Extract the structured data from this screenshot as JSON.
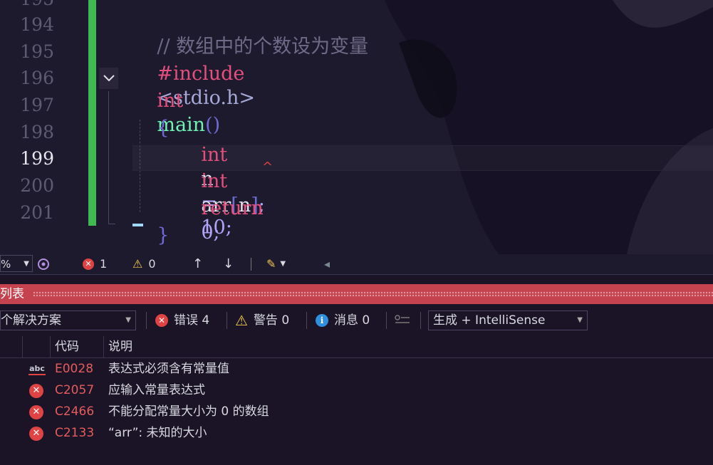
{
  "editor": {
    "line_numbers": [
      "195",
      "194",
      "195",
      "196",
      "197",
      "198",
      "199",
      "200",
      "201"
    ],
    "current_line": "199",
    "code": {
      "comment": "// 数组中的个数设为变量",
      "include_directive": "#include",
      "include_target": "<stdio.h>",
      "kw_int": "int",
      "fn_main": "main",
      "parens": "()",
      "open_brace": "{",
      "close_brace": "}",
      "var_n": "n",
      "equals": "=",
      "num_10": "10",
      "semicolon": ";",
      "var_arr": "arr",
      "bracket_open": "[",
      "bracket_close": "]",
      "kw_return": "return",
      "num_0": "0"
    },
    "squiggle": "^"
  },
  "editor_status": {
    "zoom": "%",
    "error_count": "1",
    "warning_count": "0",
    "up_arrow": "↑",
    "down_arrow": "↓",
    "left_marker": "◂"
  },
  "error_list": {
    "title": "列表",
    "scope": "个解决方案",
    "errors_label": "错误 4",
    "warnings_label": "警告 0",
    "messages_label": "消息 0",
    "build_filter": "生成 + IntelliSense",
    "columns": {
      "code": "代码",
      "description": "说明"
    },
    "rows": [
      {
        "icon": "abc",
        "code": "E0028",
        "description": "表达式必须含有常量值"
      },
      {
        "icon": "error",
        "code": "C2057",
        "description": "应输入常量表达式"
      },
      {
        "icon": "error",
        "code": "C2466",
        "description": "不能分配常量大小为 0 的数组"
      },
      {
        "icon": "error",
        "code": "C2133",
        "description": "“arr”: 未知的大小"
      }
    ]
  },
  "colors": {
    "accent_red": "#c4434e",
    "change_bar": "#3fb950",
    "keyword": "#e44f7d",
    "function": "#6ff2b3"
  }
}
